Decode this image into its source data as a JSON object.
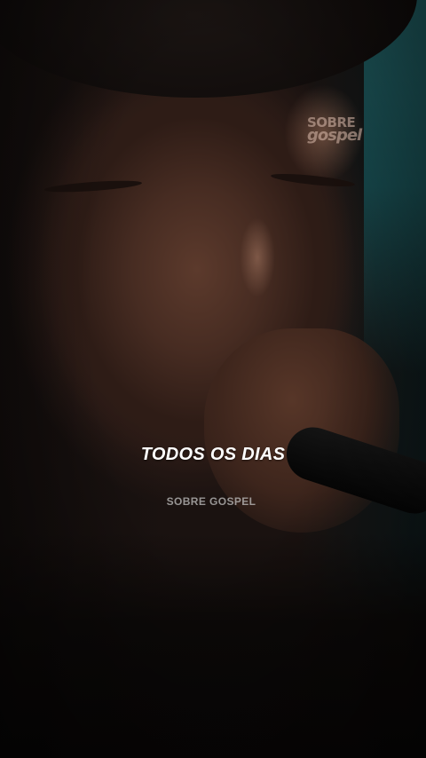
{
  "video": {
    "watermark_line1": "SOBRE",
    "watermark_line2": "gospel",
    "caption": "TODOS OS DIAS",
    "credit": "SOBRE GOSPEL"
  },
  "colors": {
    "caption_text": "#ffffff",
    "credit_text": "#c8c8c8",
    "background_teal": "#1f5a5e"
  }
}
